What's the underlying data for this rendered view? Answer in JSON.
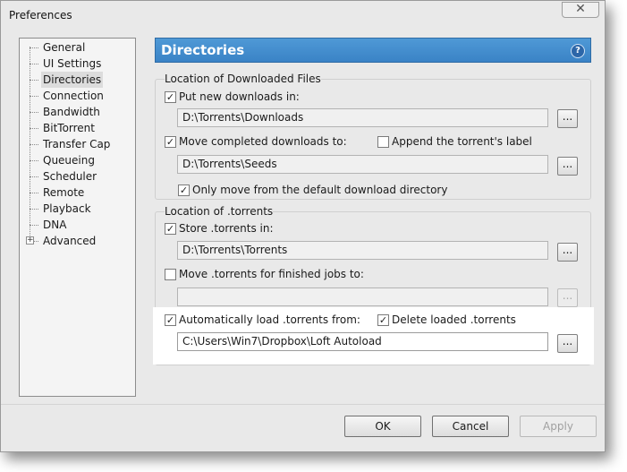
{
  "window": {
    "title": "Preferences",
    "close_glyph": "✕"
  },
  "sidebar": {
    "items": [
      {
        "label": "General"
      },
      {
        "label": "UI Settings"
      },
      {
        "label": "Directories",
        "selected": true
      },
      {
        "label": "Connection"
      },
      {
        "label": "Bandwidth"
      },
      {
        "label": "BitTorrent"
      },
      {
        "label": "Transfer Cap"
      },
      {
        "label": "Queueing"
      },
      {
        "label": "Scheduler"
      },
      {
        "label": "Remote"
      },
      {
        "label": "Playback"
      },
      {
        "label": "DNA"
      },
      {
        "label": "Advanced",
        "expandable": true
      }
    ],
    "expander_glyph": "+"
  },
  "header": {
    "title": "Directories",
    "help_glyph": "?",
    "color": "#3a83c6"
  },
  "downloaded": {
    "group_title": "Location of Downloaded Files",
    "put_new": {
      "label": "Put new downloads in:",
      "checked": true,
      "value": "D:\\Torrents\\Downloads"
    },
    "move_completed": {
      "label": "Move completed downloads to:",
      "checked": true,
      "value": "D:\\Torrents\\Seeds"
    },
    "append_label": {
      "label": "Append the torrent's label",
      "checked": false
    },
    "only_move": {
      "label": "Only move from the default download directory",
      "checked": true
    }
  },
  "torrents": {
    "group_title": "Location of .torrents",
    "store": {
      "label": "Store .torrents in:",
      "checked": true,
      "value": "D:\\Torrents\\Torrents"
    },
    "move_finished": {
      "label": "Move .torrents for finished jobs to:",
      "checked": false,
      "value": ""
    },
    "autoload": {
      "label": "Automatically load .torrents from:",
      "checked": true,
      "value": "C:\\Users\\Win7\\Dropbox\\Loft Autoload"
    },
    "delete_loaded": {
      "label": "Delete loaded .torrents",
      "checked": true
    }
  },
  "browse_label": "...",
  "buttons": {
    "ok": "OK",
    "cancel": "Cancel",
    "apply": "Apply"
  }
}
